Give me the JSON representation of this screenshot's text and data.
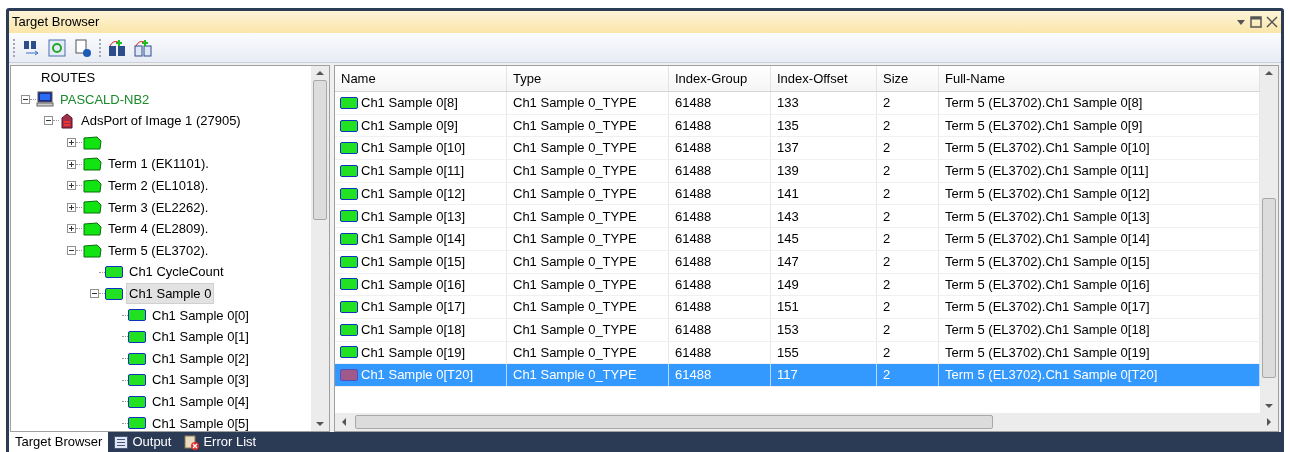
{
  "window": {
    "title": "Target Browser"
  },
  "tree": {
    "header": "ROUTES",
    "items": [
      {
        "label": "PASCALD-NB2",
        "kind": "computer",
        "expanded": true,
        "selected": false,
        "children": [
          {
            "label": "AdsPort of Image 1 (27905)",
            "kind": "port",
            "expanded": true,
            "selected": false,
            "children": [
              {
                "kind": "terminal",
                "expanded": false
              },
              {
                "label": "Term 1 (EK1101).",
                "kind": "terminal",
                "expanded": false,
                "selected": false
              },
              {
                "label": "Term 2 (EL1018).",
                "kind": "terminal",
                "expanded": false,
                "selected": false
              },
              {
                "label": "Term 3 (EL2262).",
                "kind": "terminal",
                "expanded": false,
                "selected": false
              },
              {
                "label": "Term 4 (EL2809).",
                "kind": "terminal",
                "expanded": false,
                "selected": false
              },
              {
                "label": "Term 5 (EL3702).",
                "kind": "terminal",
                "expanded": true,
                "selected": false,
                "children": [
                  {
                    "label": "Ch1 CycleCount",
                    "kind": "variable",
                    "selected": false
                  },
                  {
                    "label": "Ch1 Sample 0",
                    "kind": "variable",
                    "expanded": true,
                    "selected": true,
                    "children": [
                      {
                        "label": "Ch1 Sample 0[0]",
                        "kind": "variable",
                        "selected": false
                      },
                      {
                        "label": "Ch1 Sample 0[1]",
                        "kind": "variable",
                        "selected": false
                      },
                      {
                        "label": "Ch1 Sample 0[2]",
                        "kind": "variable",
                        "selected": false
                      },
                      {
                        "label": "Ch1 Sample 0[3]",
                        "kind": "variable",
                        "selected": false
                      },
                      {
                        "label": "Ch1 Sample 0[4]",
                        "kind": "variable",
                        "selected": false
                      },
                      {
                        "label": "Ch1 Sample 0[5]",
                        "kind": "variable",
                        "selected": false
                      }
                    ]
                  }
                ]
              }
            ]
          }
        ]
      }
    ]
  },
  "table": {
    "columns": [
      "Name",
      "Type",
      "Index-Group",
      "Index-Offset",
      "Size",
      "Full-Name"
    ],
    "rows": [
      {
        "kind": "variable",
        "selected": false,
        "cells": [
          "Ch1 Sample 0[8]",
          "Ch1 Sample 0_TYPE",
          "61488",
          "133",
          "2",
          "Term 5 (EL3702).Ch1 Sample 0[8]"
        ]
      },
      {
        "kind": "variable",
        "selected": false,
        "cells": [
          "Ch1 Sample 0[9]",
          "Ch1 Sample 0_TYPE",
          "61488",
          "135",
          "2",
          "Term 5 (EL3702).Ch1 Sample 0[9]"
        ]
      },
      {
        "kind": "variable",
        "selected": false,
        "cells": [
          "Ch1 Sample 0[10]",
          "Ch1 Sample 0_TYPE",
          "61488",
          "137",
          "2",
          "Term 5 (EL3702).Ch1 Sample 0[10]"
        ]
      },
      {
        "kind": "variable",
        "selected": false,
        "cells": [
          "Ch1 Sample 0[11]",
          "Ch1 Sample 0_TYPE",
          "61488",
          "139",
          "2",
          "Term 5 (EL3702).Ch1 Sample 0[11]"
        ]
      },
      {
        "kind": "variable",
        "selected": false,
        "cells": [
          "Ch1 Sample 0[12]",
          "Ch1 Sample 0_TYPE",
          "61488",
          "141",
          "2",
          "Term 5 (EL3702).Ch1 Sample 0[12]"
        ]
      },
      {
        "kind": "variable",
        "selected": false,
        "cells": [
          "Ch1 Sample 0[13]",
          "Ch1 Sample 0_TYPE",
          "61488",
          "143",
          "2",
          "Term 5 (EL3702).Ch1 Sample 0[13]"
        ]
      },
      {
        "kind": "variable",
        "selected": false,
        "cells": [
          "Ch1 Sample 0[14]",
          "Ch1 Sample 0_TYPE",
          "61488",
          "145",
          "2",
          "Term 5 (EL3702).Ch1 Sample 0[14]"
        ]
      },
      {
        "kind": "variable",
        "selected": false,
        "cells": [
          "Ch1 Sample 0[15]",
          "Ch1 Sample 0_TYPE",
          "61488",
          "147",
          "2",
          "Term 5 (EL3702).Ch1 Sample 0[15]"
        ]
      },
      {
        "kind": "variable",
        "selected": false,
        "cells": [
          "Ch1 Sample 0[16]",
          "Ch1 Sample 0_TYPE",
          "61488",
          "149",
          "2",
          "Term 5 (EL3702).Ch1 Sample 0[16]"
        ]
      },
      {
        "kind": "variable",
        "selected": false,
        "cells": [
          "Ch1 Sample 0[17]",
          "Ch1 Sample 0_TYPE",
          "61488",
          "151",
          "2",
          "Term 5 (EL3702).Ch1 Sample 0[17]"
        ]
      },
      {
        "kind": "variable",
        "selected": false,
        "cells": [
          "Ch1 Sample 0[18]",
          "Ch1 Sample 0_TYPE",
          "61488",
          "153",
          "2",
          "Term 5 (EL3702).Ch1 Sample 0[18]"
        ]
      },
      {
        "kind": "variable",
        "selected": false,
        "cells": [
          "Ch1 Sample 0[19]",
          "Ch1 Sample 0_TYPE",
          "61488",
          "155",
          "2",
          "Term 5 (EL3702).Ch1 Sample 0[19]"
        ]
      },
      {
        "kind": "timestamp",
        "selected": true,
        "cells": [
          "Ch1 Sample 0[T20]",
          "Ch1 Sample 0_TYPE",
          "61488",
          "117",
          "2",
          "Term 5 (EL3702).Ch1 Sample 0[T20]"
        ]
      }
    ]
  },
  "bottom_tabs": [
    {
      "label": "Target Browser",
      "kind": "browser",
      "selected": true
    },
    {
      "label": "Output",
      "kind": "output",
      "selected": false
    },
    {
      "label": "Error List",
      "kind": "errors",
      "selected": false
    }
  ]
}
